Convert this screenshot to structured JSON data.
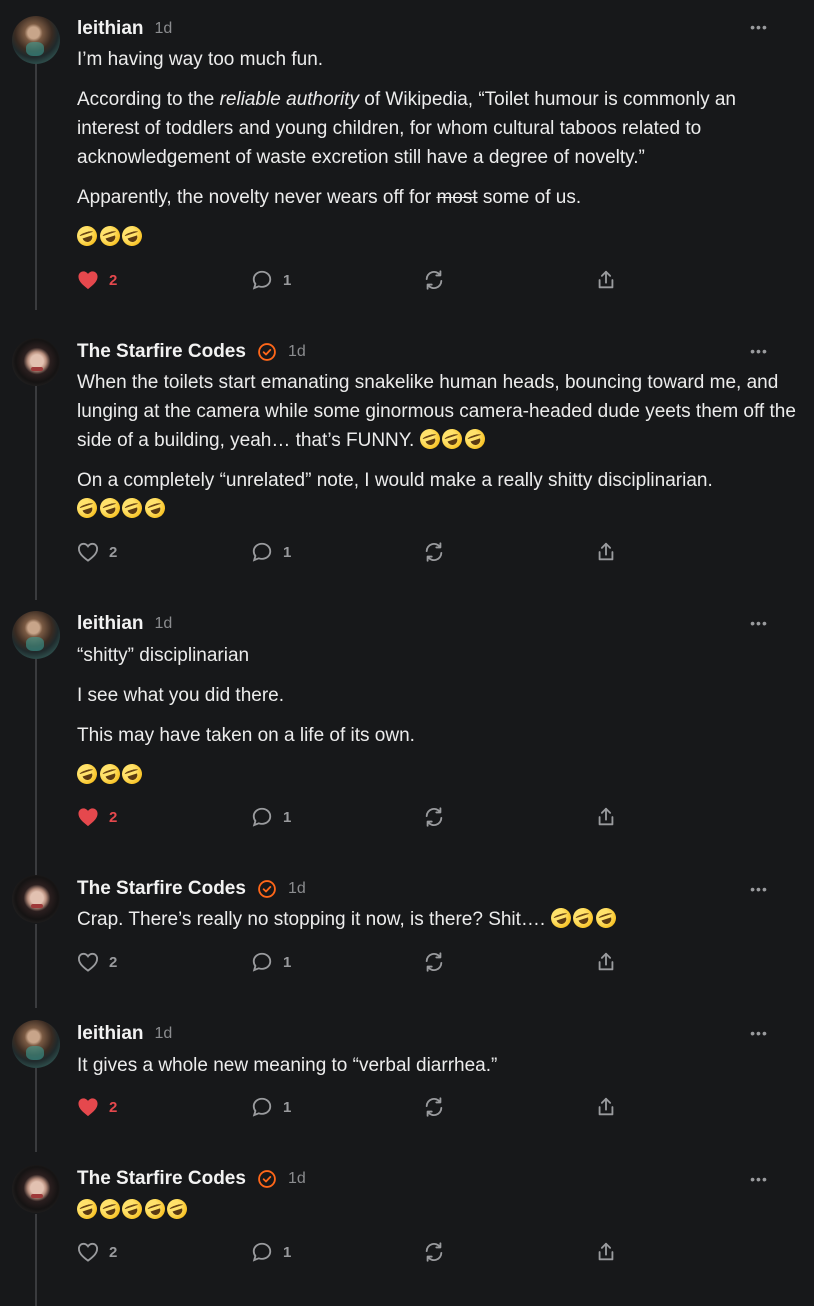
{
  "comments": [
    {
      "author": "leithian",
      "time": "1d",
      "verified": false,
      "paragraphs": [
        {
          "type": "text",
          "text": "I’m having way too much fun."
        },
        {
          "type": "rich",
          "parts": [
            "According to the ",
            "reliable authority",
            " of Wikipedia, “Toilet humour is commonly an interest of toddlers and young children, for whom cultural taboos related to acknowledgement of waste excretion still have a degree of novelty.”"
          ]
        },
        {
          "type": "rich2",
          "parts": [
            "Apparently, the novelty never wears off for ",
            "most",
            " some of us."
          ]
        },
        {
          "type": "emoji",
          "count": 3
        }
      ],
      "likes": "2",
      "liked": true,
      "replies": "1"
    },
    {
      "author": "The Starfire Codes",
      "time": "1d",
      "verified": true,
      "paragraphs": [
        {
          "type": "text_emoji",
          "text": "When the toilets start emanating snakelike human heads, bouncing toward me, and lunging at the camera while some ginormous camera-headed dude yeets them off the side of a building, yeah… that’s FUNNY. ",
          "emoji": 3
        },
        {
          "type": "text_emoji_br",
          "text": "On a completely “unrelated” note, I would make a really shitty disciplinarian.",
          "emoji": 4
        }
      ],
      "likes": "2",
      "liked": false,
      "replies": "1"
    },
    {
      "author": "leithian",
      "time": "1d",
      "verified": false,
      "paragraphs": [
        {
          "type": "text",
          "text": "“shitty” disciplinarian"
        },
        {
          "type": "text",
          "text": "I see what you did there."
        },
        {
          "type": "text",
          "text": "This may have taken on a life of its own."
        },
        {
          "type": "emoji",
          "count": 3
        }
      ],
      "likes": "2",
      "liked": true,
      "replies": "1"
    },
    {
      "author": "The Starfire Codes",
      "time": "1d",
      "verified": true,
      "paragraphs": [
        {
          "type": "text_emoji",
          "text": "Crap. There’s really no stopping it now, is there? Shit…. ",
          "emoji": 3
        }
      ],
      "likes": "2",
      "liked": false,
      "replies": "1"
    },
    {
      "author": "leithian",
      "time": "1d",
      "verified": false,
      "paragraphs": [
        {
          "type": "text",
          "text": "It gives a whole new meaning to “verbal diarrhea.”"
        }
      ],
      "likes": "2",
      "liked": true,
      "replies": "1"
    },
    {
      "author": "The Starfire Codes",
      "time": "1d",
      "verified": true,
      "paragraphs": [
        {
          "type": "emoji",
          "count": 5
        }
      ],
      "likes": "2",
      "liked": false,
      "replies": "1"
    }
  ],
  "icons": {
    "like": "heart-icon",
    "reply": "speech-bubble-icon",
    "restack": "restack-icon",
    "share": "share-icon",
    "more": "more-options-icon",
    "verified": "verified-check-icon",
    "emoji": "rofl-emoji"
  },
  "colors": {
    "background": "#17181a",
    "liked": "#e5484d",
    "verified": "#ff6719",
    "muted": "#9a9b9e"
  }
}
